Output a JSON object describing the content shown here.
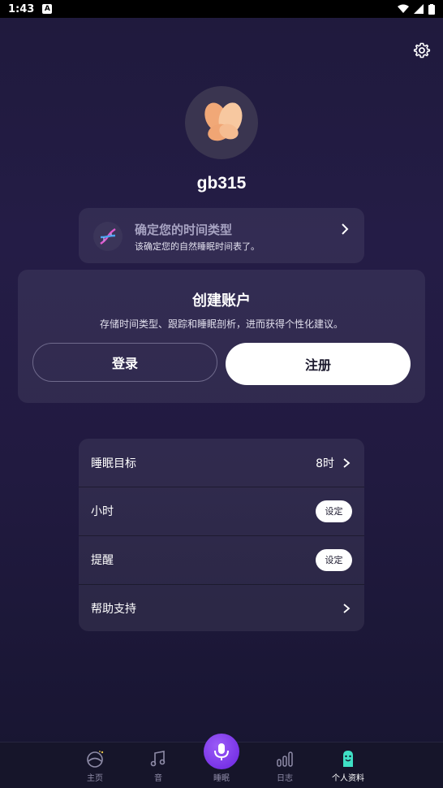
{
  "status_bar": {
    "time": "1:43",
    "notif_letter": "A"
  },
  "profile": {
    "username": "gb315"
  },
  "chronotype_card": {
    "title": "确定您的时间类型",
    "subtitle": "该确定您的自然睡眠时间表了。"
  },
  "account_card": {
    "title": "创建账户",
    "description": "存储时间类型、跟踪和睡眠剖析，进而获得个性化建议。",
    "login_label": "登录",
    "register_label": "注册"
  },
  "settings": {
    "rows": [
      {
        "label": "睡眠目标",
        "value": "8时"
      },
      {
        "label": "小时",
        "action": "设定"
      },
      {
        "label": "提醒",
        "action": "设定"
      },
      {
        "label": "帮助支持"
      }
    ]
  },
  "tabs": [
    {
      "label": "主页",
      "icon": "home-icon"
    },
    {
      "label": "音",
      "icon": "music-icon"
    },
    {
      "label": "睡眠",
      "icon": "mic-icon"
    },
    {
      "label": "日志",
      "icon": "bars-icon"
    },
    {
      "label": "个人资料",
      "icon": "profile-icon"
    }
  ],
  "colors": {
    "accent_teal": "#3fe0c5",
    "sleep_purple": "#7b34ea",
    "background": "#211a40"
  }
}
